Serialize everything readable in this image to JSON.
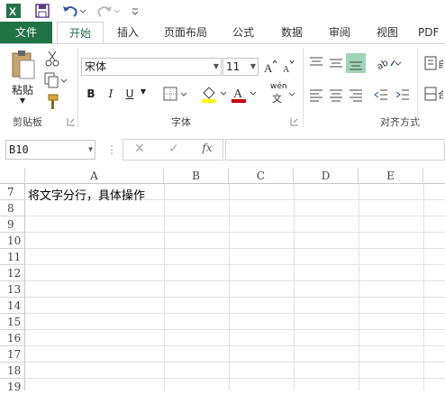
{
  "ribbon_tabs": [
    "文件",
    "开始",
    "插入",
    "页面布局",
    "公式",
    "数据",
    "审阅",
    "视图",
    "PDF"
  ],
  "clipboard": {
    "paste_label": "粘贴",
    "group_label": "剪贴板"
  },
  "font": {
    "name": "宋体",
    "size": "11",
    "group_label": "字体",
    "bold": "B",
    "italic": "I",
    "underline": "U",
    "phonetic": "wén"
  },
  "alignment": {
    "group_label": "对齐方式"
  },
  "formula_bar": {
    "name_box": "B10",
    "fx": "fx",
    "formula": ""
  },
  "columns": [
    "A",
    "B",
    "C",
    "D",
    "E"
  ],
  "rows": [
    "7",
    "8",
    "9",
    "10",
    "11",
    "12",
    "13",
    "14",
    "15",
    "16",
    "17",
    "18",
    "19"
  ],
  "cells": {
    "A7": "将文字分行，具体操作"
  },
  "colors": {
    "accent": "#217346",
    "font_color": "#c00000",
    "fill_color": "#ffff00"
  }
}
